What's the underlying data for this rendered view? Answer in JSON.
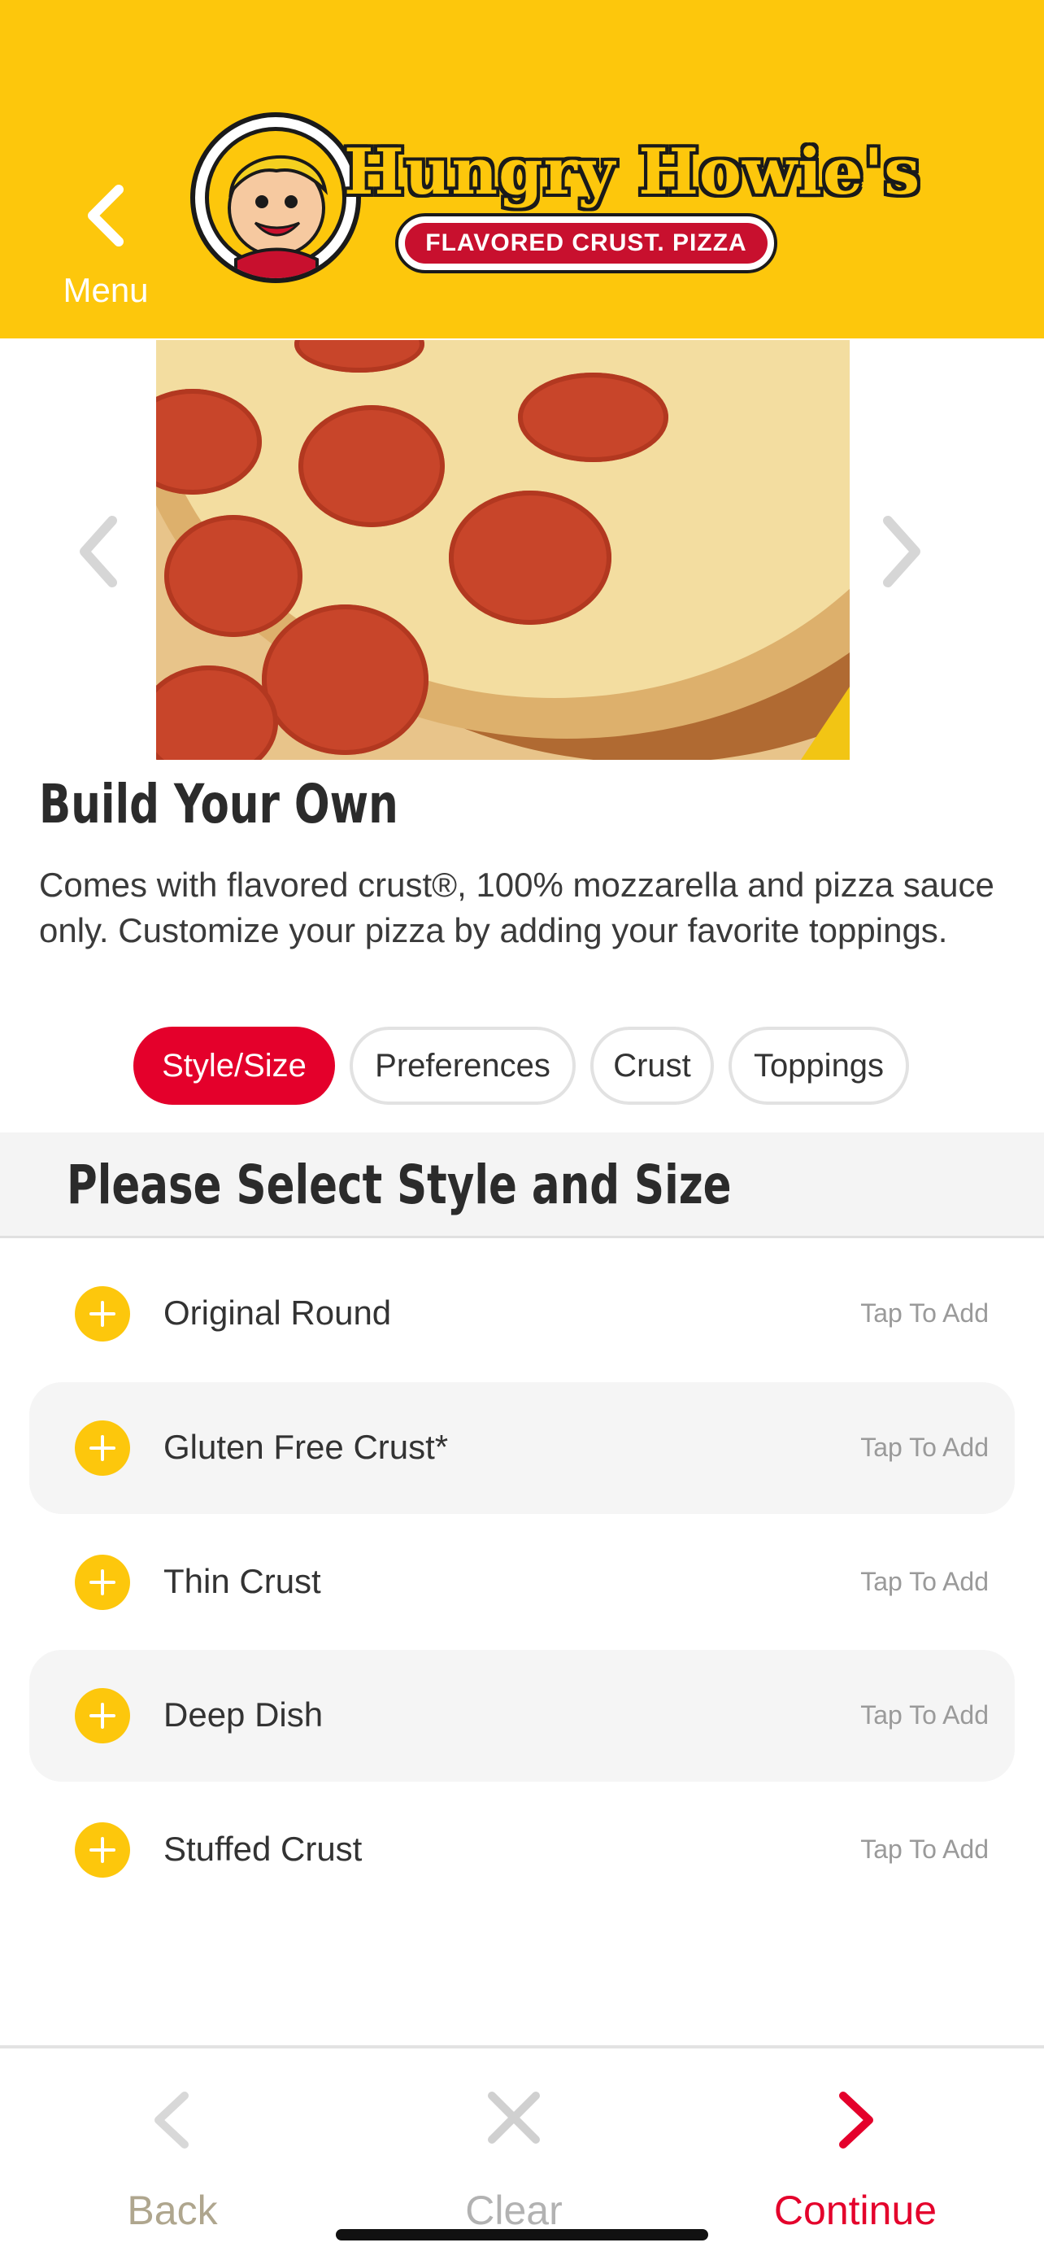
{
  "header": {
    "back_label": "Menu",
    "logo": {
      "brand": "Hungry Howie's",
      "tagline": "FLAVORED CRUST. PIZZA"
    }
  },
  "product": {
    "title": "Build Your Own",
    "description": "Comes with flavored crust®, 100% mozzarella and pizza sauce only. Customize your pizza by adding your favorite toppings."
  },
  "tabs": [
    {
      "label": "Style/Size",
      "active": true
    },
    {
      "label": "Preferences",
      "active": false
    },
    {
      "label": "Crust",
      "active": false
    },
    {
      "label": "Toppings",
      "active": false
    }
  ],
  "section": {
    "title": "Please Select Style and Size"
  },
  "options": [
    {
      "name": "Original Round",
      "action": "Tap To Add"
    },
    {
      "name": "Gluten Free Crust*",
      "action": "Tap To Add"
    },
    {
      "name": "Thin Crust",
      "action": "Tap To Add"
    },
    {
      "name": "Deep Dish",
      "action": "Tap To Add"
    },
    {
      "name": "Stuffed Crust",
      "action": "Tap To Add"
    }
  ],
  "bottom_bar": {
    "back": "Back",
    "clear": "Clear",
    "continue": "Continue"
  },
  "colors": {
    "brand_yellow": "#FDC70C",
    "accent_red": "#E4002B"
  },
  "icons": {
    "back": "chevron-left-icon",
    "carousel_prev": "chevron-left-icon",
    "carousel_next": "chevron-right-icon",
    "add": "plus-circle-icon",
    "clear": "x-icon",
    "continue": "chevron-right-icon"
  }
}
